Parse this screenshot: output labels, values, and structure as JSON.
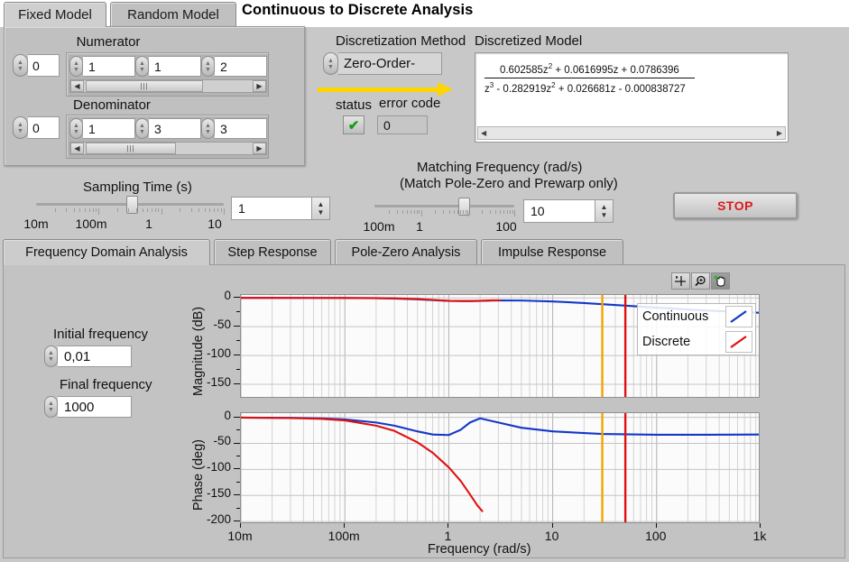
{
  "window": {
    "title": "Continuous to Discrete Analysis"
  },
  "model_tabs": [
    {
      "label": "Fixed Model",
      "active": true
    },
    {
      "label": "Random Model",
      "active": false
    }
  ],
  "fixed_model": {
    "numerator": {
      "title": "Numerator",
      "index": "0",
      "values": [
        "1",
        "1",
        "2"
      ]
    },
    "denominator": {
      "title": "Denominator",
      "index": "0",
      "values": [
        "1",
        "3",
        "3"
      ]
    }
  },
  "discretization": {
    "label": "Discretization Method",
    "selected": "Zero-Order-"
  },
  "error_cluster": {
    "status_label": "status",
    "status_glyph": "✔",
    "error_code_label": "error code",
    "error_code_value": "0"
  },
  "discretized_model": {
    "label": "Discretized Model",
    "numerator_parts": [
      {
        "text": "0.602585z",
        "sup": "2"
      },
      {
        "text": " + 0.0616995z + 0.0786396",
        "sup": ""
      }
    ],
    "denominator_parts": [
      {
        "text": "z",
        "sup": "3"
      },
      {
        "text": " - 0.282919z",
        "sup": "2"
      },
      {
        "text": " + 0.026681z - 0.000838727",
        "sup": ""
      }
    ],
    "numerator_plain": "0.602585z^2 + 0.0616995z + 0.0786396",
    "denominator_plain": "z^3 - 0.282919z^2 + 0.026681z - 0.000838727"
  },
  "sampling_time": {
    "title": "Sampling Time (s)",
    "value": "1",
    "scale_labels": [
      "10m",
      "100m",
      "1",
      "10"
    ]
  },
  "matching_frequency": {
    "title_line1": "Matching Frequency (rad/s)",
    "title_line2": "(Match Pole-Zero and Prewarp only)",
    "value": "10",
    "scale_labels": [
      "100m",
      "1",
      "100"
    ]
  },
  "stop_button": {
    "label": "STOP",
    "color": "#e01a1a"
  },
  "analysis_tabs": [
    {
      "label": "Frequency Domain Analysis",
      "active": true
    },
    {
      "label": "Step Response",
      "active": false
    },
    {
      "label": "Pole-Zero Analysis",
      "active": false
    },
    {
      "label": "Impulse Response",
      "active": false
    }
  ],
  "frequency_controls": {
    "initial_label": "Initial frequency",
    "initial_value": "0,01",
    "final_label": "Final frequency",
    "final_value": "1000"
  },
  "graph_tools": [
    {
      "name": "cursor-tool",
      "selected": false
    },
    {
      "name": "zoom-tool",
      "selected": false
    },
    {
      "name": "pan-tool",
      "selected": true
    }
  ],
  "legend": {
    "entries": [
      {
        "label": "Continuous",
        "color": "#1438c8"
      },
      {
        "label": "Discrete",
        "color": "#e01010"
      }
    ]
  },
  "chart_data": [
    {
      "type": "line",
      "title": "Magnitude",
      "xlabel": "Frequency (rad/s)",
      "ylabel": "Magnitude (dB)",
      "xscale": "log",
      "xlim": [
        0.01,
        1000
      ],
      "ylim": [
        -175,
        5
      ],
      "yticks": [
        0,
        -50,
        -100,
        -150
      ],
      "yticklabels": [
        "0",
        "-50",
        "-100",
        "-150"
      ],
      "xticks": [
        0.01,
        0.1,
        1,
        10,
        100,
        1000
      ],
      "xticklabels": [
        "10m",
        "100m",
        "1",
        "10",
        "100",
        "1k"
      ],
      "grid": true,
      "cursors": [
        {
          "x": 30,
          "color": "#f5a300"
        },
        {
          "x": 50,
          "color": "#e01010"
        }
      ],
      "series": [
        {
          "name": "Continuous",
          "color": "#1438c8",
          "x": [
            0.01,
            0.02,
            0.05,
            0.1,
            0.2,
            0.3,
            0.5,
            0.7,
            1.0,
            1.5,
            2.0,
            3.0,
            5.0,
            10,
            20,
            50,
            100,
            300,
            1000
          ],
          "y": [
            0.0,
            0.0,
            -0.1,
            -0.2,
            -0.6,
            -1.2,
            -2.6,
            -4.0,
            -5.2,
            -5.6,
            -5.2,
            -4.4,
            -4.6,
            -6.2,
            -9.0,
            -13.5,
            -17.0,
            -22.0,
            -26.0
          ]
        },
        {
          "name": "Discrete",
          "color": "#e01010",
          "x": [
            0.01,
            0.02,
            0.05,
            0.1,
            0.2,
            0.3,
            0.5,
            0.7,
            1.0,
            1.5,
            2.0,
            2.6,
            3.1
          ],
          "y": [
            0.0,
            0.0,
            -0.1,
            -0.2,
            -0.4,
            -0.8,
            -2.0,
            -3.4,
            -5.0,
            -5.5,
            -5.0,
            -4.3,
            -4.2
          ]
        }
      ]
    },
    {
      "type": "line",
      "title": "Phase",
      "xlabel": "Frequency (rad/s)",
      "ylabel": "Phase (deg)",
      "xscale": "log",
      "xlim": [
        0.01,
        1000
      ],
      "ylim": [
        -205,
        8
      ],
      "yticks": [
        0,
        -50,
        -100,
        -150,
        -200
      ],
      "yticklabels": [
        "0",
        "-50",
        "-100",
        "-150",
        "-200"
      ],
      "xticks": [
        0.01,
        0.1,
        1,
        10,
        100,
        1000
      ],
      "xticklabels": [
        "10m",
        "100m",
        "1",
        "10",
        "100",
        "1k"
      ],
      "grid": true,
      "cursors": [
        {
          "x": 30,
          "color": "#f5a300"
        },
        {
          "x": 50,
          "color": "#e01010"
        }
      ],
      "series": [
        {
          "name": "Continuous",
          "color": "#1438c8",
          "x": [
            0.01,
            0.03,
            0.06,
            0.1,
            0.2,
            0.3,
            0.5,
            0.7,
            1.0,
            1.3,
            1.6,
            2.0,
            3.0,
            5.0,
            10,
            30,
            100,
            300,
            1000
          ],
          "y": [
            -0.5,
            -1.0,
            -2.0,
            -4.0,
            -10.0,
            -16.0,
            -27.0,
            -33.0,
            -34.0,
            -24.0,
            -10.0,
            -2.0,
            -10.0,
            -20.0,
            -27.0,
            -32.0,
            -33.5,
            -33.5,
            -33.0
          ]
        },
        {
          "name": "Discrete",
          "color": "#e01010",
          "x": [
            0.01,
            0.03,
            0.06,
            0.1,
            0.2,
            0.3,
            0.5,
            0.7,
            1.0,
            1.3,
            1.6,
            1.9,
            2.1
          ],
          "y": [
            -0.5,
            -1.5,
            -3.0,
            -6.0,
            -16.0,
            -26.0,
            -48.0,
            -68.0,
            -96.0,
            -122.0,
            -148.0,
            -170.0,
            -180.0
          ]
        }
      ]
    }
  ]
}
